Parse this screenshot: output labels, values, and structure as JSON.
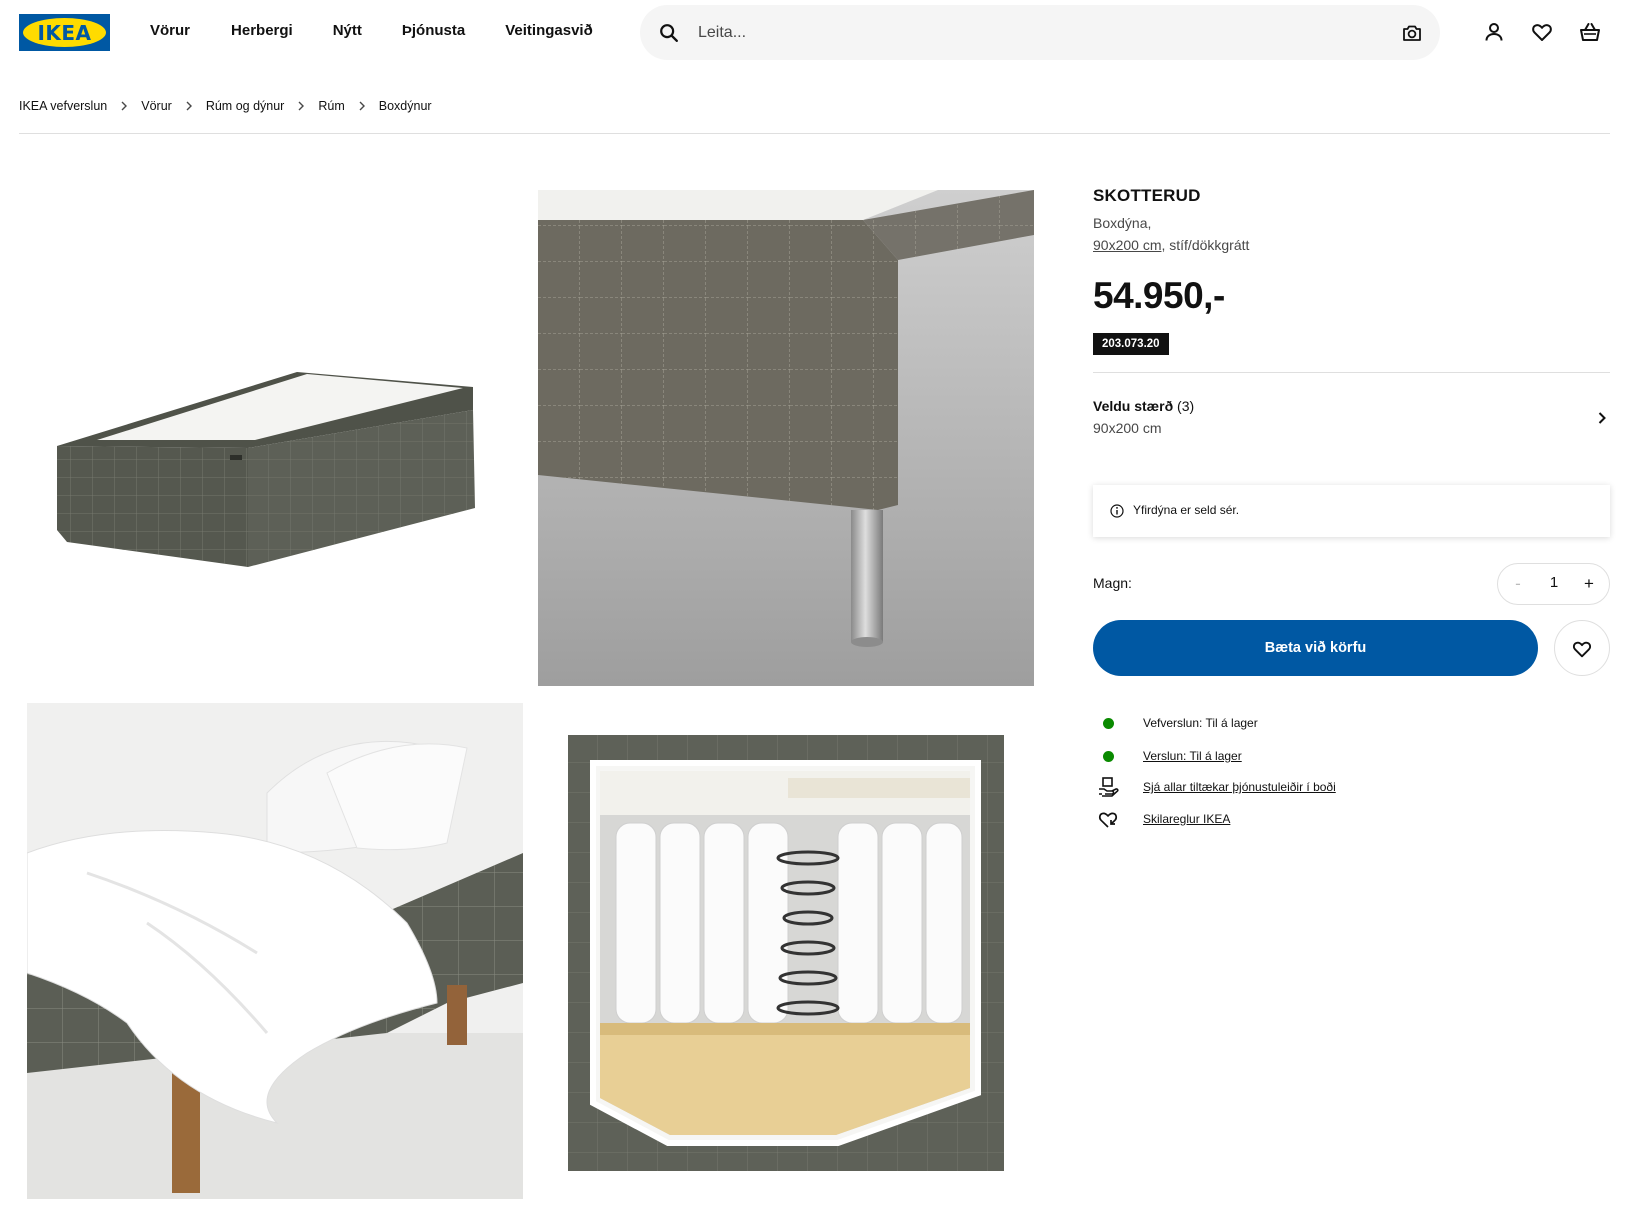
{
  "header": {
    "logo_text": "IKEA",
    "nav": [
      "Vörur",
      "Herbergi",
      "Nýtt",
      "Þjónusta",
      "Veitingasvið"
    ],
    "search_placeholder": "Leita..."
  },
  "breadcrumb": [
    "IKEA vefverslun",
    "Vörur",
    "Rúm og dýnur",
    "Rúm",
    "Boxdýnur"
  ],
  "gallery": {
    "images": [
      "product-main",
      "leg-closeup",
      "bed-with-bedding",
      "mattress-cutaway"
    ]
  },
  "product": {
    "name": "SKOTTERUD",
    "description": "Boxdýna,",
    "size_link": "90x200 cm",
    "size_suffix": ", stíf/dökkgrátt",
    "price": "54.950,-",
    "article_number": "203.073.20"
  },
  "size_selector": {
    "title": "Veldu stærð",
    "count": "(3)",
    "value": "90x200 cm"
  },
  "info": {
    "text": "Yfirdýna er seld sér."
  },
  "quantity": {
    "label": "Magn:",
    "minus": "-",
    "value": "1",
    "plus": "+"
  },
  "actions": {
    "add_to_cart": "Bæta við körfu"
  },
  "availability": {
    "online": "Vefverslun: Til á lager",
    "store": "Verslun: Til á lager",
    "services": "Sjá allar tiltækar þjónustuleiðir í boði",
    "returns": "Skilareglur IKEA"
  },
  "colors": {
    "brand_blue": "#0058a3",
    "brand_yellow": "#ffdb00",
    "in_stock": "#0a8a00"
  }
}
